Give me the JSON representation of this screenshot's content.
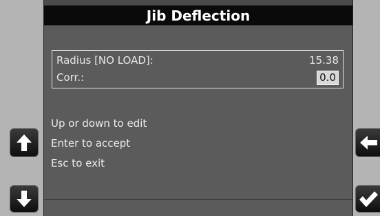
{
  "title": "Jib Deflection",
  "info": {
    "radius_label": "Radius [NO LOAD]:",
    "radius_value": "15.38",
    "corr_label": "Corr.:",
    "corr_value": "0.0"
  },
  "instructions": [
    "Up or down to edit",
    "Enter to accept",
    "Esc to exit"
  ],
  "buttons": {
    "up": "arrow-up-icon",
    "down": "arrow-down-icon",
    "back": "arrow-left-icon",
    "accept": "checkmark-icon"
  }
}
